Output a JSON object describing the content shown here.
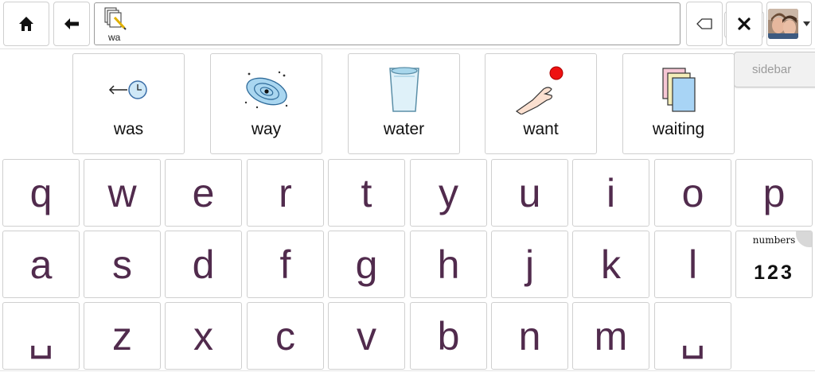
{
  "toolbar": {
    "home_icon": "home-icon",
    "back_icon": "arrow-left-icon",
    "expand_icon": "chevron-down-icon",
    "backspace_icon": "backspace-icon",
    "clear_icon": "close-icon",
    "avatar_icon": "user-avatar",
    "caret_icon": "caret-down-icon"
  },
  "message": {
    "word": "wa",
    "symbol_icon": "write-pencil-icon"
  },
  "sidebar": {
    "label": "sidebar"
  },
  "predictions": [
    {
      "label": "was",
      "icon": "clock-arrow-icon"
    },
    {
      "label": "way",
      "icon": "galaxy-icon"
    },
    {
      "label": "water",
      "icon": "glass-of-water-icon"
    },
    {
      "label": "want",
      "icon": "hand-reaching-icon"
    },
    {
      "label": "waiting",
      "icon": "stack-of-pages-icon"
    }
  ],
  "keyboard": {
    "row1": [
      "q",
      "w",
      "e",
      "r",
      "t",
      "y",
      "u",
      "i",
      "o",
      "p"
    ],
    "row2": [
      "a",
      "s",
      "d",
      "f",
      "g",
      "h",
      "j",
      "k",
      "l"
    ],
    "row3": [
      "␣",
      "z",
      "x",
      "c",
      "v",
      "b",
      "n",
      "m",
      "␣"
    ],
    "numbers_key": {
      "title": "numbers",
      "digits": "123"
    }
  },
  "colors": {
    "key_text": "#512b4d",
    "border": "#cfcfcf",
    "sidebar_bg": "#f1f1f1"
  }
}
